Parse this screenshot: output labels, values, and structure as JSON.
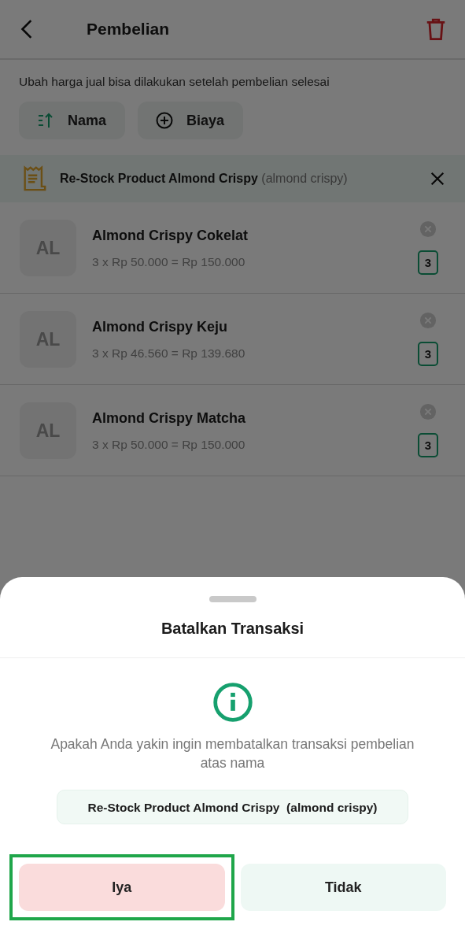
{
  "header": {
    "title": "Pembelian"
  },
  "notice": "Ubah harga jual bisa dilakukan setelah pembelian selesai",
  "chips": [
    {
      "label": "Nama",
      "kind": "sort"
    },
    {
      "label": "Biaya",
      "kind": "add"
    }
  ],
  "purchase": {
    "name": "Re-Stock Product Almond Crispy",
    "note": "(almond crispy)"
  },
  "items": [
    {
      "initials": "AL",
      "name": "Almond Crispy Cokelat",
      "subtotal": "3 x Rp 50.000 = Rp 150.000",
      "quantity": "3"
    },
    {
      "initials": "AL",
      "name": "Almond Crispy Keju",
      "subtotal": "3 x Rp 46.560 = Rp 139.680",
      "quantity": "3"
    },
    {
      "initials": "AL",
      "name": "Almond Crispy Matcha",
      "subtotal": "3 x Rp 50.000 = Rp 150.000",
      "quantity": "3"
    }
  ],
  "dialog": {
    "title": "Batalkan Transaksi",
    "message": "Apakah Anda yakin ingin membatalkan transaksi pembelian atas nama",
    "subject": "Re-Stock Product Almond Crispy  (almond crispy)",
    "buttons": [
      {
        "label": "Iya",
        "kind": "confirm",
        "highlighted": true
      },
      {
        "label": "Tidak",
        "kind": "cancel",
        "highlighted": false
      }
    ]
  }
}
